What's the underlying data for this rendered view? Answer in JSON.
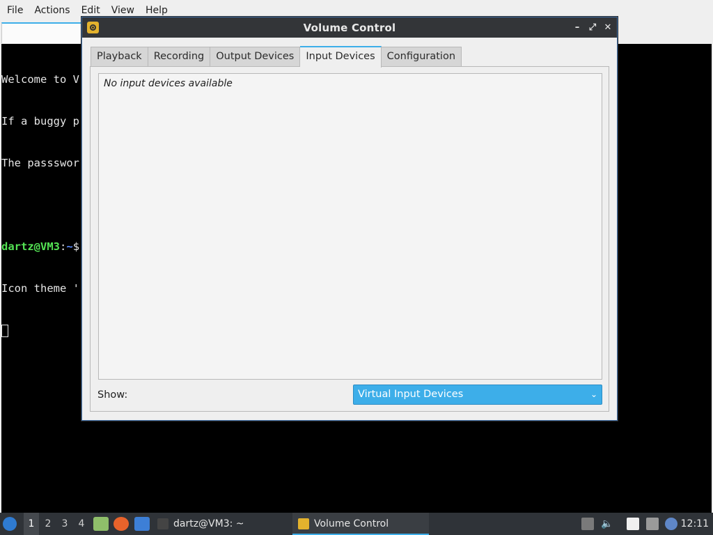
{
  "terminal": {
    "menu": [
      "File",
      "Actions",
      "Edit",
      "View",
      "Help"
    ],
    "lines": [
      "Welcome to V",
      "If a buggy p",
      "The passswor",
      ""
    ],
    "prompt_user": "dartz@VM3",
    "prompt_sep": ":",
    "prompt_path": "~",
    "prompt_end": "$",
    "line_after_prompt": "Icon theme '"
  },
  "volume_control": {
    "title": "Volume Control",
    "window_controls": {
      "minimize": "–",
      "maximize": "⤢",
      "close": "✕"
    },
    "tabs": [
      "Playback",
      "Recording",
      "Output Devices",
      "Input Devices",
      "Configuration"
    ],
    "active_tab": "Input Devices",
    "empty_message": "No input devices available",
    "show_label": "Show:",
    "show_selected": "Virtual Input Devices"
  },
  "taskbar": {
    "workspaces": [
      "1",
      "2",
      "3",
      "4"
    ],
    "active_workspace": "1",
    "tasks": [
      {
        "label": "dartz@VM3: ~",
        "icon": "terminal-icon"
      },
      {
        "label": "Volume Control",
        "icon": "volume-control-icon"
      }
    ],
    "clock": "12:11"
  },
  "colors": {
    "accent": "#3daee9",
    "titlebar": "#333538",
    "taskbar": "#2f3338",
    "prompt_user": "#54e354"
  }
}
